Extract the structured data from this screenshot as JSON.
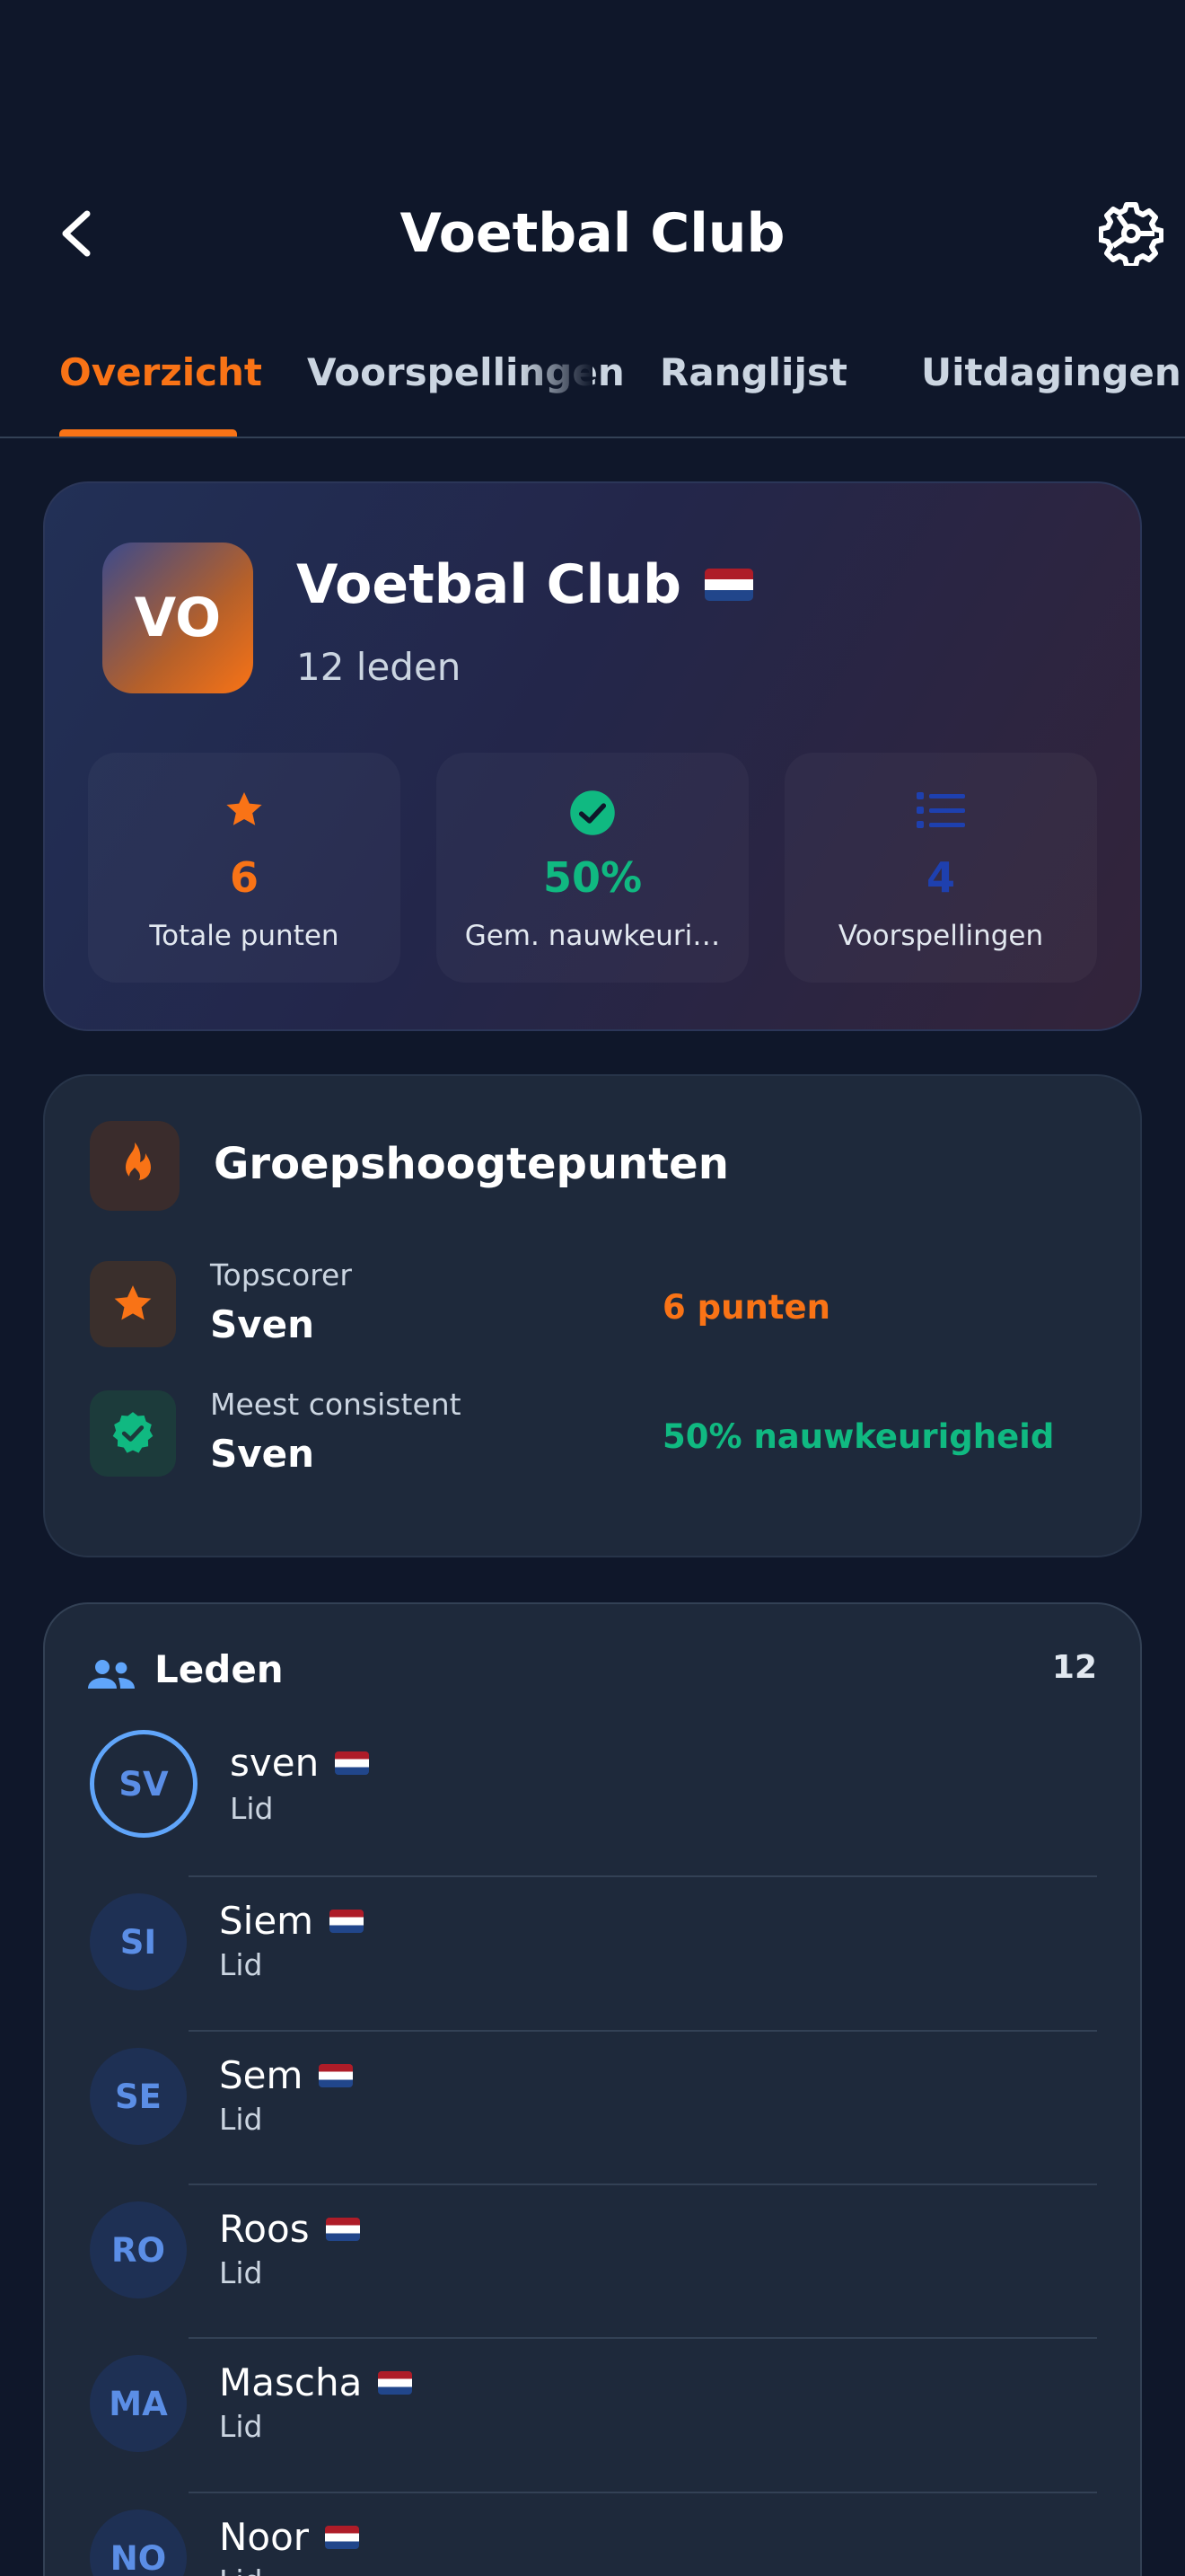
{
  "header": {
    "title": "Voetbal Club",
    "back_icon": "chevron-left-icon",
    "settings_icon": "gear-icon"
  },
  "tabs": [
    {
      "label": "Overzicht",
      "active": true
    },
    {
      "label": "Voorspellingen",
      "active": false
    },
    {
      "label": "Ranglijst",
      "active": false
    },
    {
      "label": "Uitdagingen",
      "active": false
    }
  ],
  "club": {
    "initials": "VO",
    "name": "Voetbal Club",
    "members_text": "12 leden",
    "stats": [
      {
        "icon": "star-icon",
        "value": "6",
        "label": "Totale punten",
        "color": "#f97316"
      },
      {
        "icon": "check-circle-icon",
        "value": "50%",
        "label": "Gem. nauwkeuri…",
        "color": "#10b981"
      },
      {
        "icon": "list-icon",
        "value": "4",
        "label": "Voorspellingen",
        "color": "#1e40af"
      }
    ]
  },
  "highlights": {
    "title": "Groepshoogtepunten",
    "rows": [
      {
        "label": "Topscorer",
        "name": "Sven",
        "value": "6 punten",
        "color": "#f97316"
      },
      {
        "label": "Meest consistent",
        "name": "Sven",
        "value": "50% nauwkeurigheid",
        "color": "#10b981"
      }
    ]
  },
  "members": {
    "title": "Leden",
    "count": "12",
    "list": [
      {
        "initials": "SV",
        "name": "sven",
        "role": "Lid"
      },
      {
        "initials": "SI",
        "name": "Siem",
        "role": "Lid"
      },
      {
        "initials": "SE",
        "name": "Sem",
        "role": "Lid"
      },
      {
        "initials": "RO",
        "name": "Roos",
        "role": "Lid"
      },
      {
        "initials": "MA",
        "name": "Mascha",
        "role": "Lid"
      },
      {
        "initials": "NO",
        "name": "Noor",
        "role": "Lid"
      }
    ]
  },
  "colors": {
    "background": "#0f172a",
    "accent": "#f97316",
    "success": "#10b981",
    "card": "#1e293b"
  }
}
